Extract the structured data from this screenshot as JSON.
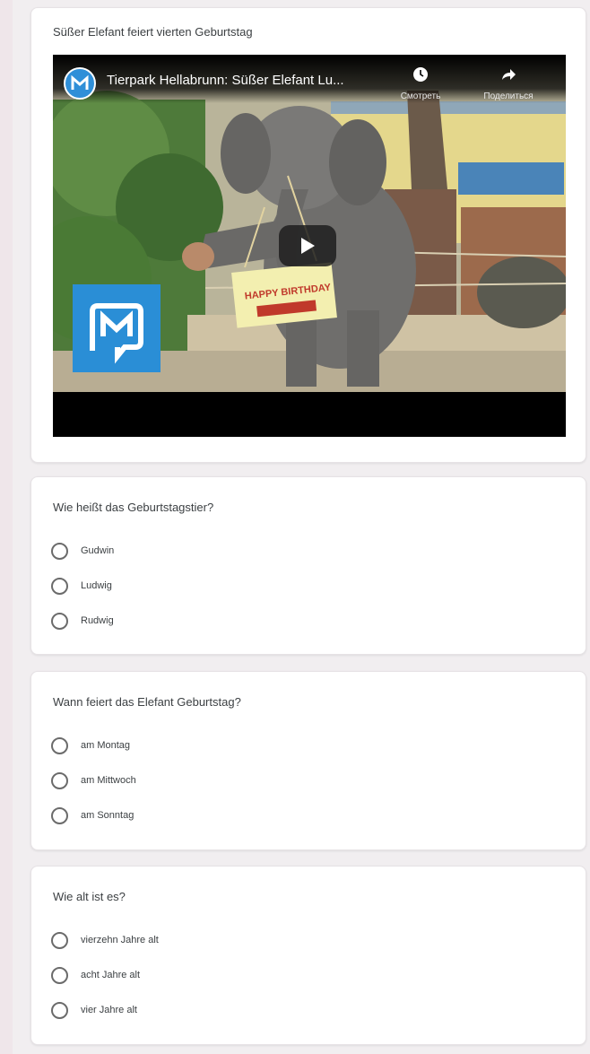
{
  "video_card": {
    "title": "Süßer Elefant feiert vierten Geburtstag",
    "player": {
      "channel_logo_icon": "m-logo-icon",
      "video_title": "Tierpark Hellabrunn: Süßer Elefant Lu...",
      "watch_later_label": "Смотреть",
      "share_label": "Поделиться",
      "sign_text": "HAPPY BIRTHDAY"
    }
  },
  "questions": [
    {
      "title": "Wie heißt das Geburtstagstier?",
      "options": [
        "Gudwin",
        "Ludwig",
        "Rudwig"
      ]
    },
    {
      "title": "Wann feiert das Elefant Geburtstag?",
      "options": [
        "am Montag",
        "am Mittwoch",
        "am Sonntag"
      ]
    },
    {
      "title": "Wie alt ist es?",
      "options": [
        "vierzehn Jahre alt",
        "acht Jahre alt",
        "vier Jahre alt"
      ]
    }
  ],
  "colors": {
    "page_background": "#f1eef0",
    "card_background": "#ffffff",
    "brand_blue": "#2a8ed6"
  }
}
